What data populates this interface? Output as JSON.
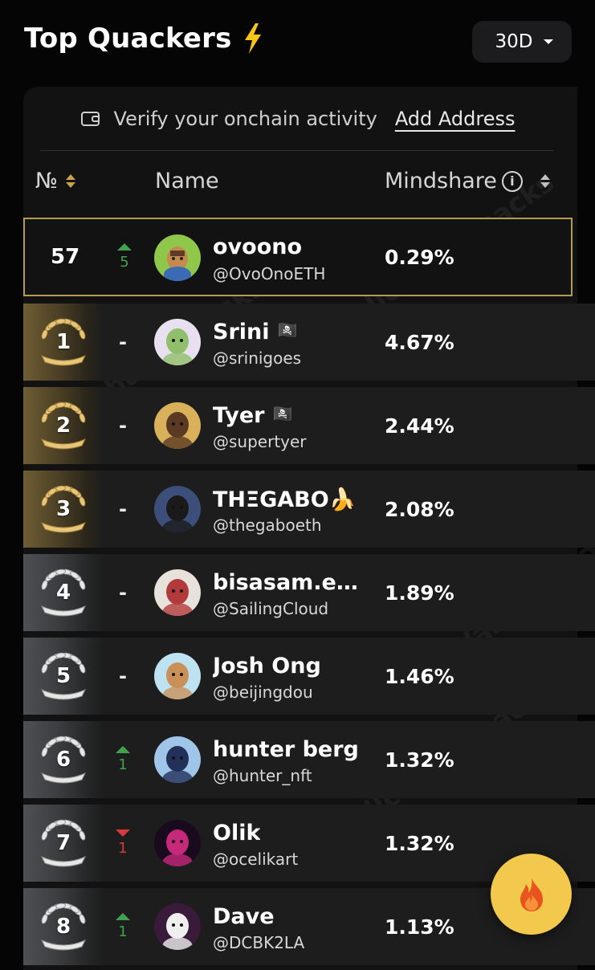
{
  "header": {
    "title": "Top Quackers",
    "period": "30D"
  },
  "verify": {
    "text": "Verify your onchain activity",
    "link": "Add Address"
  },
  "columns": {
    "rank": "№",
    "name": "Name",
    "mindshare": "Mindshare",
    "info_glyph": "i"
  },
  "self_row": {
    "rank": "57",
    "change": "5",
    "change_dir": "up",
    "name": "ovoono",
    "handle": "@OvoOnoETH",
    "mindshare": "0.29%"
  },
  "rows": [
    {
      "rank": "1",
      "change": "-",
      "change_dir": "none",
      "name": "Srini",
      "flag": "🏴‍☠️",
      "handle": "@srinigoes",
      "mindshare": "4.67%",
      "tier": "gold"
    },
    {
      "rank": "2",
      "change": "-",
      "change_dir": "none",
      "name": "Tyer",
      "flag": "🏴‍☠️",
      "handle": "@supertyer",
      "mindshare": "2.44%",
      "tier": "gold"
    },
    {
      "rank": "3",
      "change": "-",
      "change_dir": "none",
      "name": "THΞGABO🍌",
      "flag": "",
      "handle": "@thegaboeth",
      "mindshare": "2.08%",
      "tier": "gold"
    },
    {
      "rank": "4",
      "change": "-",
      "change_dir": "none",
      "name": "bisasam.eth...",
      "flag": "",
      "handle": "@SailingCloud",
      "mindshare": "1.89%",
      "tier": "silver"
    },
    {
      "rank": "5",
      "change": "-",
      "change_dir": "none",
      "name": "Josh Ong",
      "flag": "",
      "handle": "@beijingdou",
      "mindshare": "1.46%",
      "tier": "silver"
    },
    {
      "rank": "6",
      "change": "1",
      "change_dir": "up",
      "name": "hunter berg",
      "flag": "",
      "handle": "@hunter_nft",
      "mindshare": "1.32%",
      "tier": "silver"
    },
    {
      "rank": "7",
      "change": "1",
      "change_dir": "down",
      "name": "Olik",
      "flag": "",
      "handle": "@ocelikart",
      "mindshare": "1.32%",
      "tier": "silver"
    },
    {
      "rank": "8",
      "change": "1",
      "change_dir": "up",
      "name": "Dave",
      "flag": "",
      "handle": "@DCBK2LA",
      "mindshare": "1.13%",
      "tier": "silver"
    }
  ],
  "watermark": "Wallchain Quacks",
  "colors": {
    "gold": "#b39b4f",
    "up": "#3fa34d",
    "down": "#d63b3b",
    "fab": "#f2c94c",
    "bolt": "#f5c518"
  },
  "icons": {
    "title": "lightning-bolt-icon",
    "period": "caret-down-icon",
    "verify": "wallet-icon",
    "fab": "flame-icon",
    "rank_badge": "laurel-wreath-icon"
  }
}
